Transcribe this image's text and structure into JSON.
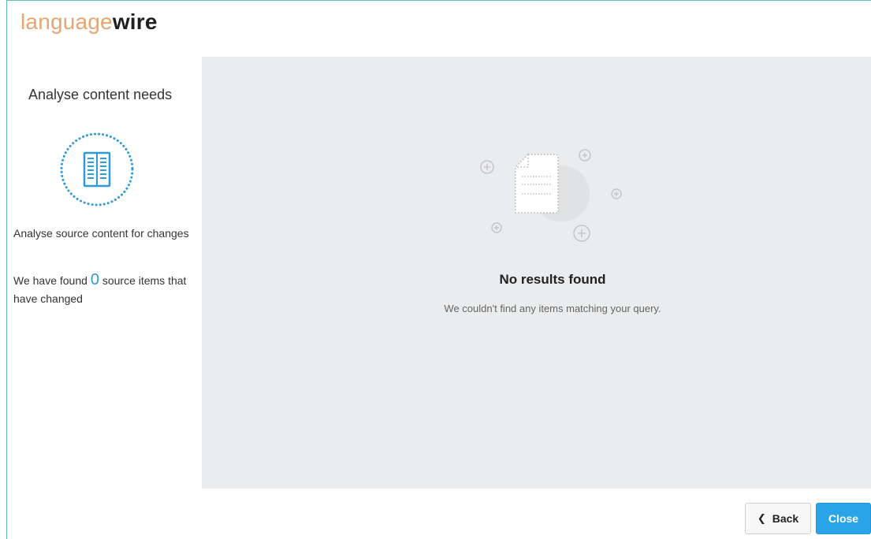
{
  "brand": {
    "logo_light": "language",
    "logo_bold": "wire"
  },
  "sidebar": {
    "title": "Analyse content needs",
    "icon": "book-icon",
    "description": "Analyse source content for changes",
    "found_prefix": "We have found",
    "found_count": "0",
    "found_suffix": "source items that have changed"
  },
  "main": {
    "icon": "empty-document-icon",
    "empty_title": "No results found",
    "empty_message": "We couldn't find any items matching your query."
  },
  "footer": {
    "back_icon": "chevron-left-icon",
    "back_label": "Back",
    "close_label": "Close"
  },
  "colors": {
    "frame": "#5bbdb6",
    "logo_light": "#e8a574",
    "accent": "#2aa4e8",
    "count": "#2f9ad6",
    "panel_bg": "#ebeced"
  }
}
